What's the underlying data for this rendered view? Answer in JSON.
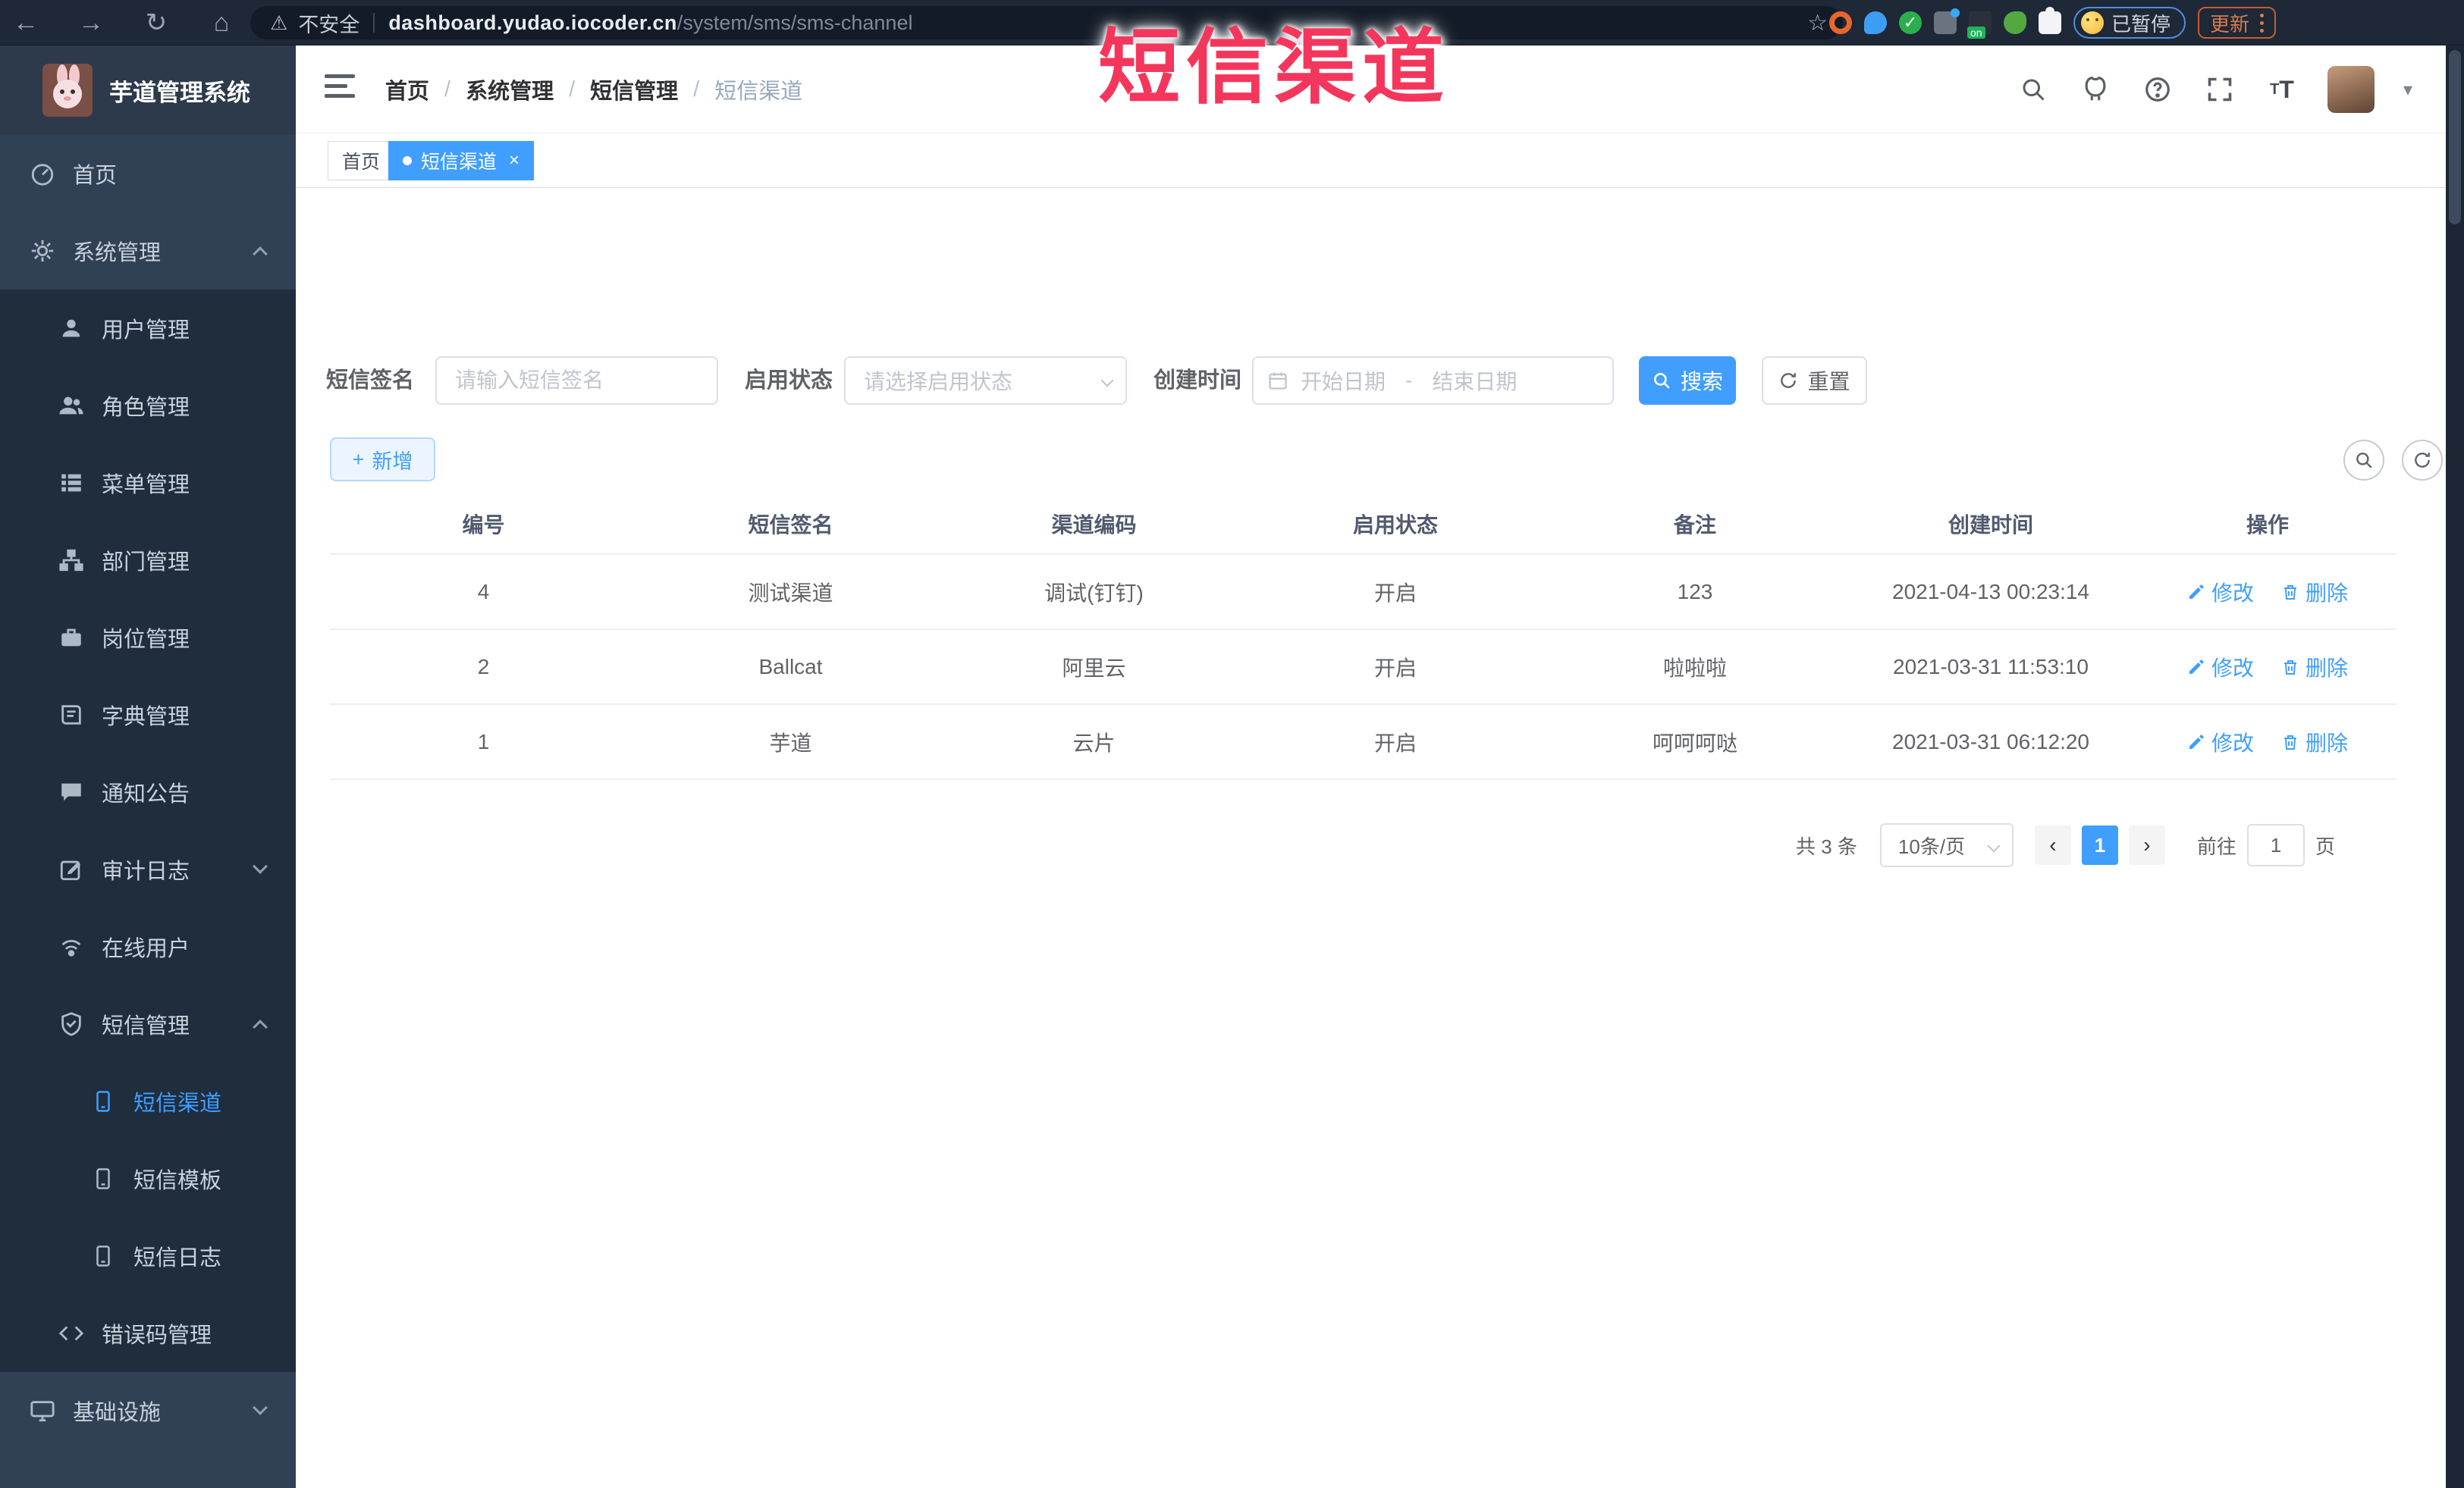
{
  "colors": {
    "accent": "#409EFF",
    "overlay_red": "#f5365c",
    "sidebar_bg": "#304156",
    "sidebar_sub_bg": "#1f2d3d",
    "browser_bg": "#1e2836"
  },
  "browser": {
    "security_label": "不安全",
    "url_host": "dashboard.yudao.iocoder.cn",
    "url_path": "/system/sms/sms-channel",
    "paused_label": "已暂停",
    "update_label": "更新",
    "extension_on_badge": "on",
    "icons": {
      "back": "←",
      "forward": "→",
      "reload": "↻",
      "home": "⌂",
      "warning": "⚠",
      "star": "☆",
      "check": "✓"
    }
  },
  "overlay": {
    "title": "短信渠道"
  },
  "sidebar": {
    "logo_title": "芋道管理系统",
    "items": [
      {
        "label": "首页"
      },
      {
        "label": "系统管理"
      },
      {
        "label": "用户管理"
      },
      {
        "label": "角色管理"
      },
      {
        "label": "菜单管理"
      },
      {
        "label": "部门管理"
      },
      {
        "label": "岗位管理"
      },
      {
        "label": "字典管理"
      },
      {
        "label": "通知公告"
      },
      {
        "label": "审计日志"
      },
      {
        "label": "在线用户"
      },
      {
        "label": "短信管理"
      },
      {
        "label": "短信渠道"
      },
      {
        "label": "短信模板"
      },
      {
        "label": "短信日志"
      },
      {
        "label": "错误码管理"
      },
      {
        "label": "基础设施"
      }
    ]
  },
  "header": {
    "breadcrumb": [
      "首页",
      "系统管理",
      "短信管理",
      "短信渠道"
    ],
    "separator": "/",
    "caret": "▾"
  },
  "tabs": [
    {
      "label": "首页"
    },
    {
      "label": "短信渠道",
      "close": "×"
    }
  ],
  "filter": {
    "sign_label": "短信签名",
    "sign_placeholder": "请输入短信签名",
    "status_label": "启用状态",
    "status_placeholder": "请选择启用状态",
    "time_label": "创建时间",
    "start_placeholder": "开始日期",
    "range_separator": "-",
    "end_placeholder": "结束日期",
    "search_label": "搜索",
    "reset_label": "重置"
  },
  "toolbar": {
    "add_label": "新增",
    "plus": "+"
  },
  "table": {
    "columns": [
      "编号",
      "短信签名",
      "渠道编码",
      "启用状态",
      "备注",
      "创建时间",
      "操作"
    ],
    "edit_label": "修改",
    "delete_label": "删除",
    "rows": [
      {
        "id": "4",
        "signature": "测试渠道",
        "code": "调试(钉钉)",
        "status": "开启",
        "remark": "123",
        "created": "2021-04-13 00:23:14"
      },
      {
        "id": "2",
        "signature": "Ballcat",
        "code": "阿里云",
        "status": "开启",
        "remark": "啦啦啦",
        "created": "2021-03-31 11:53:10"
      },
      {
        "id": "1",
        "signature": "芋道",
        "code": "云片",
        "status": "开启",
        "remark": "呵呵呵哒",
        "created": "2021-03-31 06:12:20"
      }
    ]
  },
  "pagination": {
    "total_label": "共 3 条",
    "page_size_label": "10条/页",
    "prev": "‹",
    "next": "›",
    "current_page": "1",
    "goto_label": "前往",
    "goto_value": "1",
    "unit_label": "页"
  }
}
